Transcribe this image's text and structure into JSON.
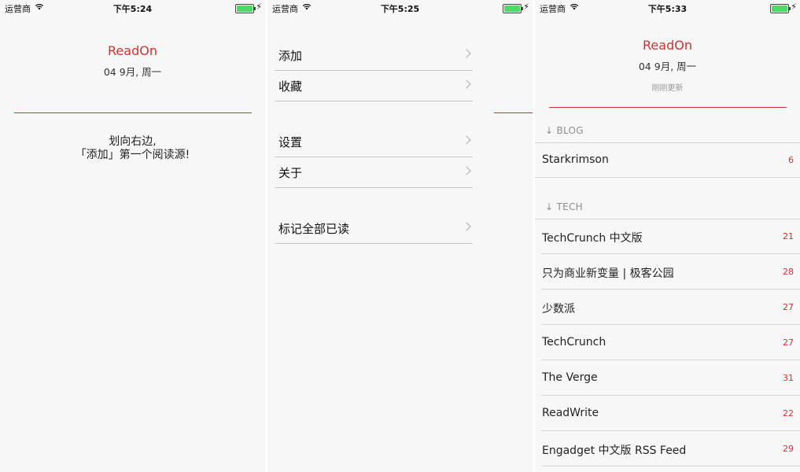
{
  "screens": [
    {
      "status": {
        "carrier": "运营商",
        "time": "下午5:24"
      },
      "title": "ReadOn",
      "date": "04 9月, 周一",
      "empty_message": [
        "划向右边,",
        "「添加」第一个阅读源!"
      ]
    },
    {
      "status": {
        "carrier": "运营商",
        "time": "下午5:25"
      },
      "menu": [
        "添加",
        "收藏",
        "设置",
        "关于",
        "标记全部已读"
      ]
    },
    {
      "status": {
        "carrier": "运营商",
        "time": "下午5:33"
      },
      "title": "ReadOn",
      "date": "04 9月, 周一",
      "updated": "刚刚更新",
      "sections": [
        {
          "header": "↓ BLOG",
          "feeds": [
            {
              "name": "Starkrimson",
              "count": "6"
            }
          ]
        },
        {
          "header": "↓ TECH",
          "feeds": [
            {
              "name": "TechCrunch 中文版",
              "count": "21"
            },
            {
              "name": "只为商业新变量 | 极客公园",
              "count": "28"
            },
            {
              "name": "少数派",
              "count": "27"
            },
            {
              "name": "TechCrunch",
              "count": "27"
            },
            {
              "name": "The Verge",
              "count": "31"
            },
            {
              "name": "ReadWrite",
              "count": "22"
            },
            {
              "name": "Engadget 中文版 RSS Feed",
              "count": "29"
            }
          ]
        }
      ]
    }
  ],
  "colors": {
    "accent": "#d0302f",
    "battery": "#4cd964",
    "background": "#f7f7f7"
  },
  "icons": [
    "wifi-icon",
    "battery-icon",
    "charging-bolt-icon",
    "chevron-right-icon",
    "arrow-down-icon"
  ]
}
